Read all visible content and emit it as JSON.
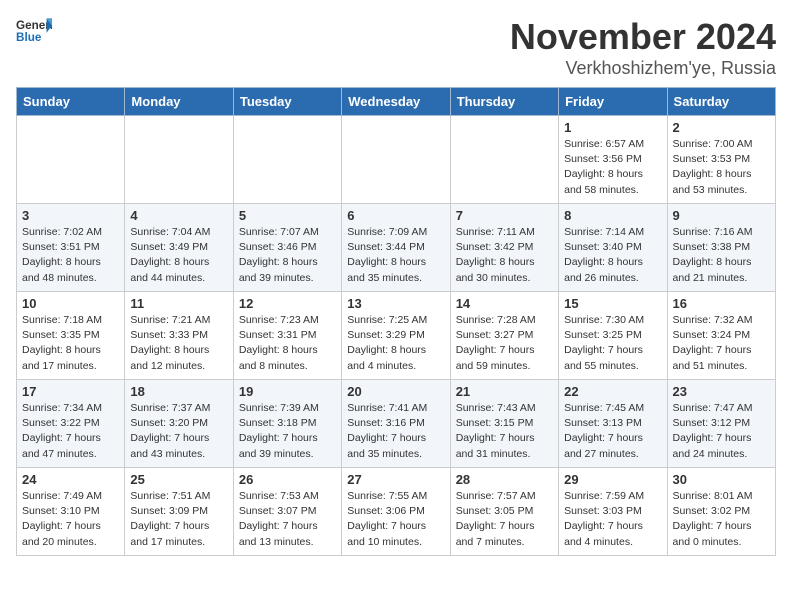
{
  "header": {
    "logo_general": "General",
    "logo_blue": "Blue",
    "month_title": "November 2024",
    "location": "Verkhoshizhem'ye, Russia"
  },
  "weekdays": [
    "Sunday",
    "Monday",
    "Tuesday",
    "Wednesday",
    "Thursday",
    "Friday",
    "Saturday"
  ],
  "weeks": [
    [
      {
        "day": "",
        "info": ""
      },
      {
        "day": "",
        "info": ""
      },
      {
        "day": "",
        "info": ""
      },
      {
        "day": "",
        "info": ""
      },
      {
        "day": "",
        "info": ""
      },
      {
        "day": "1",
        "info": "Sunrise: 6:57 AM\nSunset: 3:56 PM\nDaylight: 8 hours\nand 58 minutes."
      },
      {
        "day": "2",
        "info": "Sunrise: 7:00 AM\nSunset: 3:53 PM\nDaylight: 8 hours\nand 53 minutes."
      }
    ],
    [
      {
        "day": "3",
        "info": "Sunrise: 7:02 AM\nSunset: 3:51 PM\nDaylight: 8 hours\nand 48 minutes."
      },
      {
        "day": "4",
        "info": "Sunrise: 7:04 AM\nSunset: 3:49 PM\nDaylight: 8 hours\nand 44 minutes."
      },
      {
        "day": "5",
        "info": "Sunrise: 7:07 AM\nSunset: 3:46 PM\nDaylight: 8 hours\nand 39 minutes."
      },
      {
        "day": "6",
        "info": "Sunrise: 7:09 AM\nSunset: 3:44 PM\nDaylight: 8 hours\nand 35 minutes."
      },
      {
        "day": "7",
        "info": "Sunrise: 7:11 AM\nSunset: 3:42 PM\nDaylight: 8 hours\nand 30 minutes."
      },
      {
        "day": "8",
        "info": "Sunrise: 7:14 AM\nSunset: 3:40 PM\nDaylight: 8 hours\nand 26 minutes."
      },
      {
        "day": "9",
        "info": "Sunrise: 7:16 AM\nSunset: 3:38 PM\nDaylight: 8 hours\nand 21 minutes."
      }
    ],
    [
      {
        "day": "10",
        "info": "Sunrise: 7:18 AM\nSunset: 3:35 PM\nDaylight: 8 hours\nand 17 minutes."
      },
      {
        "day": "11",
        "info": "Sunrise: 7:21 AM\nSunset: 3:33 PM\nDaylight: 8 hours\nand 12 minutes."
      },
      {
        "day": "12",
        "info": "Sunrise: 7:23 AM\nSunset: 3:31 PM\nDaylight: 8 hours\nand 8 minutes."
      },
      {
        "day": "13",
        "info": "Sunrise: 7:25 AM\nSunset: 3:29 PM\nDaylight: 8 hours\nand 4 minutes."
      },
      {
        "day": "14",
        "info": "Sunrise: 7:28 AM\nSunset: 3:27 PM\nDaylight: 7 hours\nand 59 minutes."
      },
      {
        "day": "15",
        "info": "Sunrise: 7:30 AM\nSunset: 3:25 PM\nDaylight: 7 hours\nand 55 minutes."
      },
      {
        "day": "16",
        "info": "Sunrise: 7:32 AM\nSunset: 3:24 PM\nDaylight: 7 hours\nand 51 minutes."
      }
    ],
    [
      {
        "day": "17",
        "info": "Sunrise: 7:34 AM\nSunset: 3:22 PM\nDaylight: 7 hours\nand 47 minutes."
      },
      {
        "day": "18",
        "info": "Sunrise: 7:37 AM\nSunset: 3:20 PM\nDaylight: 7 hours\nand 43 minutes."
      },
      {
        "day": "19",
        "info": "Sunrise: 7:39 AM\nSunset: 3:18 PM\nDaylight: 7 hours\nand 39 minutes."
      },
      {
        "day": "20",
        "info": "Sunrise: 7:41 AM\nSunset: 3:16 PM\nDaylight: 7 hours\nand 35 minutes."
      },
      {
        "day": "21",
        "info": "Sunrise: 7:43 AM\nSunset: 3:15 PM\nDaylight: 7 hours\nand 31 minutes."
      },
      {
        "day": "22",
        "info": "Sunrise: 7:45 AM\nSunset: 3:13 PM\nDaylight: 7 hours\nand 27 minutes."
      },
      {
        "day": "23",
        "info": "Sunrise: 7:47 AM\nSunset: 3:12 PM\nDaylight: 7 hours\nand 24 minutes."
      }
    ],
    [
      {
        "day": "24",
        "info": "Sunrise: 7:49 AM\nSunset: 3:10 PM\nDaylight: 7 hours\nand 20 minutes."
      },
      {
        "day": "25",
        "info": "Sunrise: 7:51 AM\nSunset: 3:09 PM\nDaylight: 7 hours\nand 17 minutes."
      },
      {
        "day": "26",
        "info": "Sunrise: 7:53 AM\nSunset: 3:07 PM\nDaylight: 7 hours\nand 13 minutes."
      },
      {
        "day": "27",
        "info": "Sunrise: 7:55 AM\nSunset: 3:06 PM\nDaylight: 7 hours\nand 10 minutes."
      },
      {
        "day": "28",
        "info": "Sunrise: 7:57 AM\nSunset: 3:05 PM\nDaylight: 7 hours\nand 7 minutes."
      },
      {
        "day": "29",
        "info": "Sunrise: 7:59 AM\nSunset: 3:03 PM\nDaylight: 7 hours\nand 4 minutes."
      },
      {
        "day": "30",
        "info": "Sunrise: 8:01 AM\nSunset: 3:02 PM\nDaylight: 7 hours\nand 0 minutes."
      }
    ]
  ]
}
